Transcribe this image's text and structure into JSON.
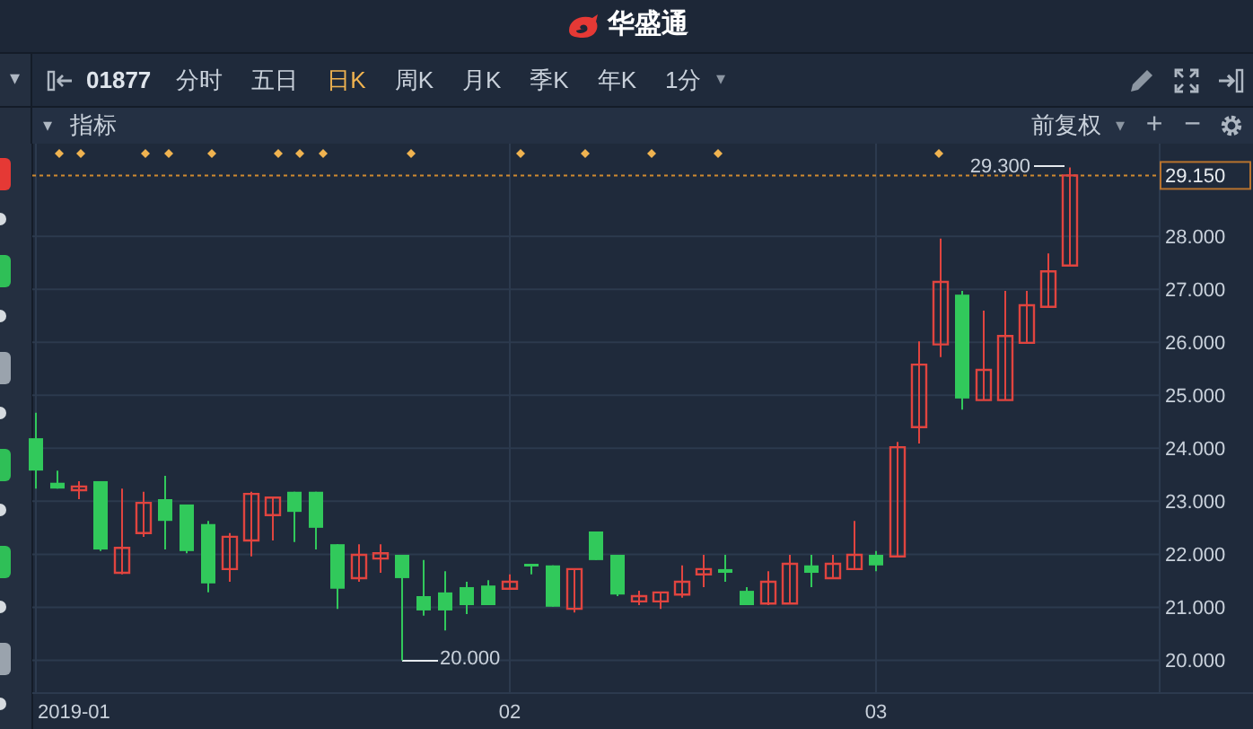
{
  "header": {
    "title": "华盛通"
  },
  "toolbar": {
    "menu_caret": "▾",
    "code": "01877",
    "periods": [
      {
        "label": "分时",
        "selected": false
      },
      {
        "label": "五日",
        "selected": false
      },
      {
        "label": "日K",
        "selected": true
      },
      {
        "label": "周K",
        "selected": false
      },
      {
        "label": "月K",
        "selected": false
      },
      {
        "label": "季K",
        "selected": false
      },
      {
        "label": "年K",
        "selected": false
      }
    ],
    "interval": "1分",
    "interval_caret": "▾"
  },
  "indicator_bar": {
    "caret": "▾",
    "label": "指标",
    "adjustment": "前复权",
    "adjustment_caret": "▾",
    "plus": "+",
    "minus": "−"
  },
  "side_markers": [
    {
      "color": "#e53935"
    },
    {
      "color": "#2fbf57"
    },
    {
      "color": "#9aa3ad"
    },
    {
      "color": "#2fbf57"
    },
    {
      "color": "#2fbf57"
    },
    {
      "color": "#9aa3ad"
    }
  ],
  "chart": {
    "high_label": "29.300",
    "low_label": "20.000",
    "start_date_label": "2019-01",
    "chart_data": {
      "type": "candlestick",
      "categories": [
        null,
        null,
        null,
        null,
        null,
        null,
        null,
        null,
        null,
        null,
        null,
        null,
        null,
        null,
        null,
        null,
        null,
        null,
        null,
        null,
        null,
        null,
        "02",
        null,
        null,
        null,
        null,
        null,
        null,
        null,
        null,
        null,
        null,
        null,
        null,
        null,
        null,
        null,
        null,
        "03",
        null,
        null,
        null,
        null,
        null,
        null,
        null,
        null,
        null
      ],
      "grid": true,
      "ref_lines": [
        {
          "axis": "y",
          "value": 29.15,
          "label": "29.150"
        }
      ],
      "ohlc": [
        [
          24.19,
          24.67,
          23.24,
          23.58
        ],
        [
          23.35,
          23.58,
          23.24,
          23.24
        ],
        [
          23.21,
          23.38,
          23.04,
          23.28
        ],
        [
          23.38,
          23.38,
          22.06,
          22.09
        ],
        [
          21.65,
          23.24,
          21.62,
          22.12
        ],
        [
          22.4,
          23.18,
          22.33,
          22.97
        ],
        [
          23.04,
          23.48,
          22.09,
          22.63
        ],
        [
          22.94,
          22.94,
          22.02,
          22.06
        ],
        [
          22.57,
          22.63,
          21.28,
          21.45
        ],
        [
          21.72,
          22.4,
          21.48,
          22.33
        ],
        [
          22.26,
          23.18,
          21.96,
          23.14
        ],
        [
          22.74,
          23.07,
          22.26,
          23.07
        ],
        [
          23.18,
          23.18,
          22.23,
          22.8
        ],
        [
          23.18,
          23.18,
          22.09,
          22.5
        ],
        [
          22.19,
          22.19,
          20.97,
          21.35
        ],
        [
          21.55,
          22.19,
          21.48,
          21.99
        ],
        [
          21.92,
          22.19,
          21.65,
          22.02
        ],
        [
          21.99,
          21.99,
          20.0,
          21.55
        ],
        [
          21.21,
          21.89,
          20.84,
          20.94
        ],
        [
          21.28,
          21.68,
          20.56,
          20.94
        ],
        [
          21.38,
          21.48,
          20.87,
          21.04
        ],
        [
          21.41,
          21.51,
          21.04,
          21.04
        ],
        [
          21.35,
          21.62,
          21.35,
          21.48
        ],
        [
          21.82,
          21.82,
          21.62,
          21.79
        ],
        [
          21.79,
          21.79,
          21.01,
          21.01
        ],
        [
          20.97,
          21.72,
          20.9,
          21.72
        ],
        [
          22.43,
          22.43,
          21.89,
          21.89
        ],
        [
          21.99,
          21.99,
          21.21,
          21.24
        ],
        [
          21.11,
          21.31,
          21.04,
          21.21
        ],
        [
          21.11,
          21.28,
          20.97,
          21.28
        ],
        [
          21.24,
          21.79,
          21.18,
          21.48
        ],
        [
          21.62,
          21.99,
          21.38,
          21.72
        ],
        [
          21.72,
          21.99,
          21.48,
          21.65
        ],
        [
          21.31,
          21.38,
          21.04,
          21.04
        ],
        [
          21.07,
          21.68,
          21.04,
          21.48
        ],
        [
          21.07,
          21.99,
          21.07,
          21.82
        ],
        [
          21.79,
          21.99,
          21.38,
          21.65
        ],
        [
          21.55,
          21.99,
          21.55,
          21.82
        ],
        [
          21.72,
          22.63,
          21.72,
          21.99
        ],
        [
          21.99,
          22.06,
          21.68,
          21.79
        ],
        [
          21.96,
          24.12,
          21.96,
          24.02
        ],
        [
          24.4,
          26.02,
          24.09,
          25.58
        ],
        [
          25.96,
          27.96,
          25.72,
          27.14
        ],
        [
          26.9,
          26.97,
          24.73,
          24.94
        ],
        [
          24.91,
          26.6,
          24.91,
          25.48
        ],
        [
          24.91,
          26.97,
          24.91,
          26.12
        ],
        [
          25.99,
          26.97,
          25.99,
          26.7
        ],
        [
          26.67,
          27.68,
          26.67,
          27.34
        ],
        [
          27.45,
          29.3,
          27.45,
          29.15
        ]
      ],
      "ylim": [
        19.38,
        29.75
      ],
      "yticks": [
        {
          "value": 28,
          "label": "28.000"
        },
        {
          "value": 27,
          "label": "27.000"
        },
        {
          "value": 26,
          "label": "26.000"
        },
        {
          "value": 25,
          "label": "25.000"
        },
        {
          "value": 24,
          "label": "24.000"
        },
        {
          "value": 23,
          "label": "23.000"
        },
        {
          "value": 22,
          "label": "22.000"
        },
        {
          "value": 21,
          "label": "21.000"
        },
        {
          "value": 20,
          "label": "20.000"
        }
      ]
    }
  }
}
